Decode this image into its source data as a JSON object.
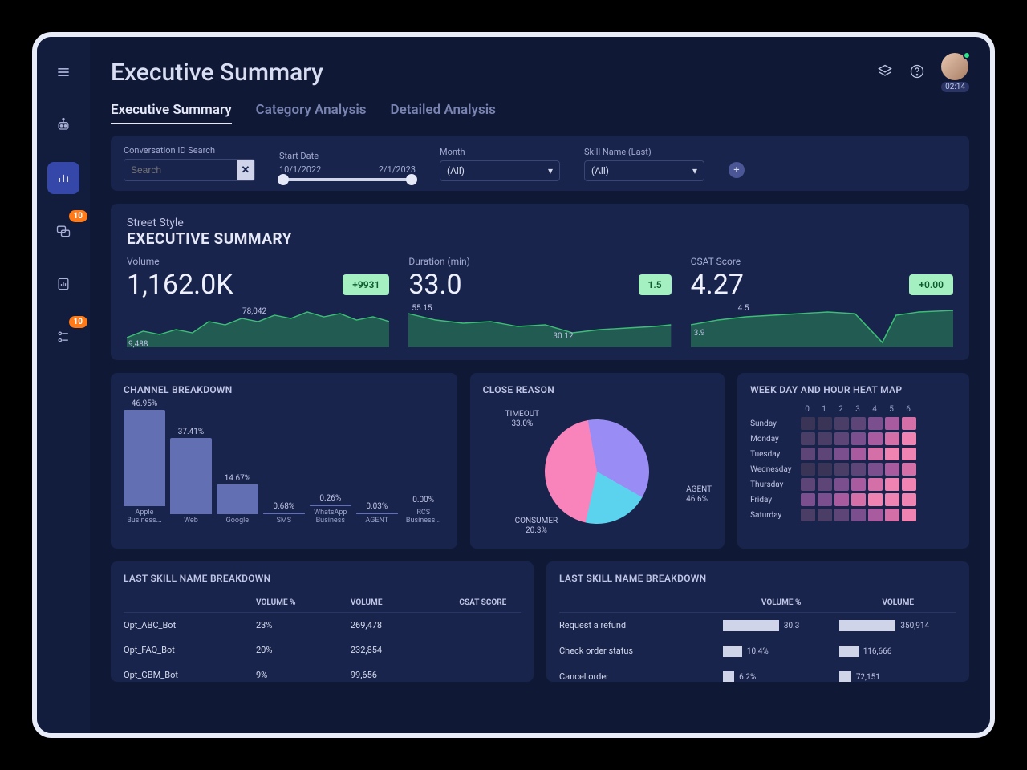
{
  "header": {
    "title": "Executive Summary",
    "timer": "02:14"
  },
  "sidebar": {
    "chat_badge": "10",
    "flow_badge": "10"
  },
  "tabs": [
    "Executive Summary",
    "Category Analysis",
    "Detailed Analysis"
  ],
  "filters": {
    "search_label": "Conversation ID Search",
    "search_placeholder": "Search",
    "start_date_label": "Start Date",
    "start_date": "10/1/2022",
    "end_date": "2/1/2023",
    "month_label": "Month",
    "month_value": "(All)",
    "skill_label": "Skill Name (Last)",
    "skill_value": "(All)"
  },
  "summary": {
    "brand": "Street Style",
    "title": "EXECUTIVE SUMMARY",
    "kpis": [
      {
        "label": "Volume",
        "value": "1,162.0K",
        "delta": "+9931",
        "marks": {
          "low": "9,488",
          "high": "78,042"
        }
      },
      {
        "label": "Duration (min)",
        "value": "33.0",
        "delta": "1.5",
        "marks": {
          "low": "30.12",
          "high": "55.15"
        }
      },
      {
        "label": "CSAT Score",
        "value": "4.27",
        "delta": "+0.00",
        "marks": {
          "low": "3.9",
          "high": "4.5"
        }
      }
    ]
  },
  "chart_data": {
    "channel_breakdown": {
      "type": "bar",
      "title": "CHANNEL BREAKDOWN",
      "categories": [
        "Apple Business...",
        "Web",
        "Google",
        "SMS",
        "WhatsApp Business",
        "AGENT",
        "RCS Business..."
      ],
      "values": [
        46.95,
        37.41,
        14.67,
        0.68,
        0.26,
        0.03,
        0.0
      ],
      "value_suffix": "%"
    },
    "close_reason": {
      "type": "pie",
      "title": "CLOSE REASON",
      "slices": [
        {
          "name": "AGENT",
          "value": 46.6,
          "color": "#5cd3ee"
        },
        {
          "name": "TIMEOUT",
          "value": 33.0,
          "color": "#9a8cf5"
        },
        {
          "name": "CONSUMER",
          "value": 20.3,
          "color": "#f884bb"
        }
      ]
    },
    "heatmap": {
      "type": "heatmap",
      "title": "WEEK DAY AND HOUR HEAT MAP",
      "days": [
        "Sunday",
        "Monday",
        "Tuesday",
        "Wednesday",
        "Thursday",
        "Friday",
        "Saturday"
      ],
      "hours": [
        0,
        1,
        2,
        3,
        4,
        5,
        6
      ]
    }
  },
  "skill_table_left": {
    "title": "LAST SKILL NAME BREAKDOWN",
    "columns": [
      "",
      "VOLUME %",
      "VOLUME",
      "CSAT SCORE"
    ],
    "rows": [
      {
        "name": "Opt_ABC_Bot",
        "pct": "23%",
        "vol": "269,478"
      },
      {
        "name": "Opt_FAQ_Bot",
        "pct": "20%",
        "vol": "232,854"
      },
      {
        "name": "Opt_GBM_Bot",
        "pct": "9%",
        "vol": "99,656"
      }
    ]
  },
  "skill_table_right": {
    "title": "LAST SKILL NAME BREAKDOWN",
    "columns": [
      "",
      "VOLUME %",
      "VOLUME"
    ],
    "rows": [
      {
        "name": "Request a refund",
        "pct_v": 30.3,
        "pct": "30.3",
        "vol_v": 350914,
        "vol": "350,914"
      },
      {
        "name": "Check order status",
        "pct_v": 10.4,
        "pct": "10.4%",
        "vol_v": 116666,
        "vol": "116,666"
      },
      {
        "name": "Cancel order",
        "pct_v": 6.2,
        "pct": "6.2%",
        "vol_v": 72151,
        "vol": "72,151"
      }
    ]
  }
}
